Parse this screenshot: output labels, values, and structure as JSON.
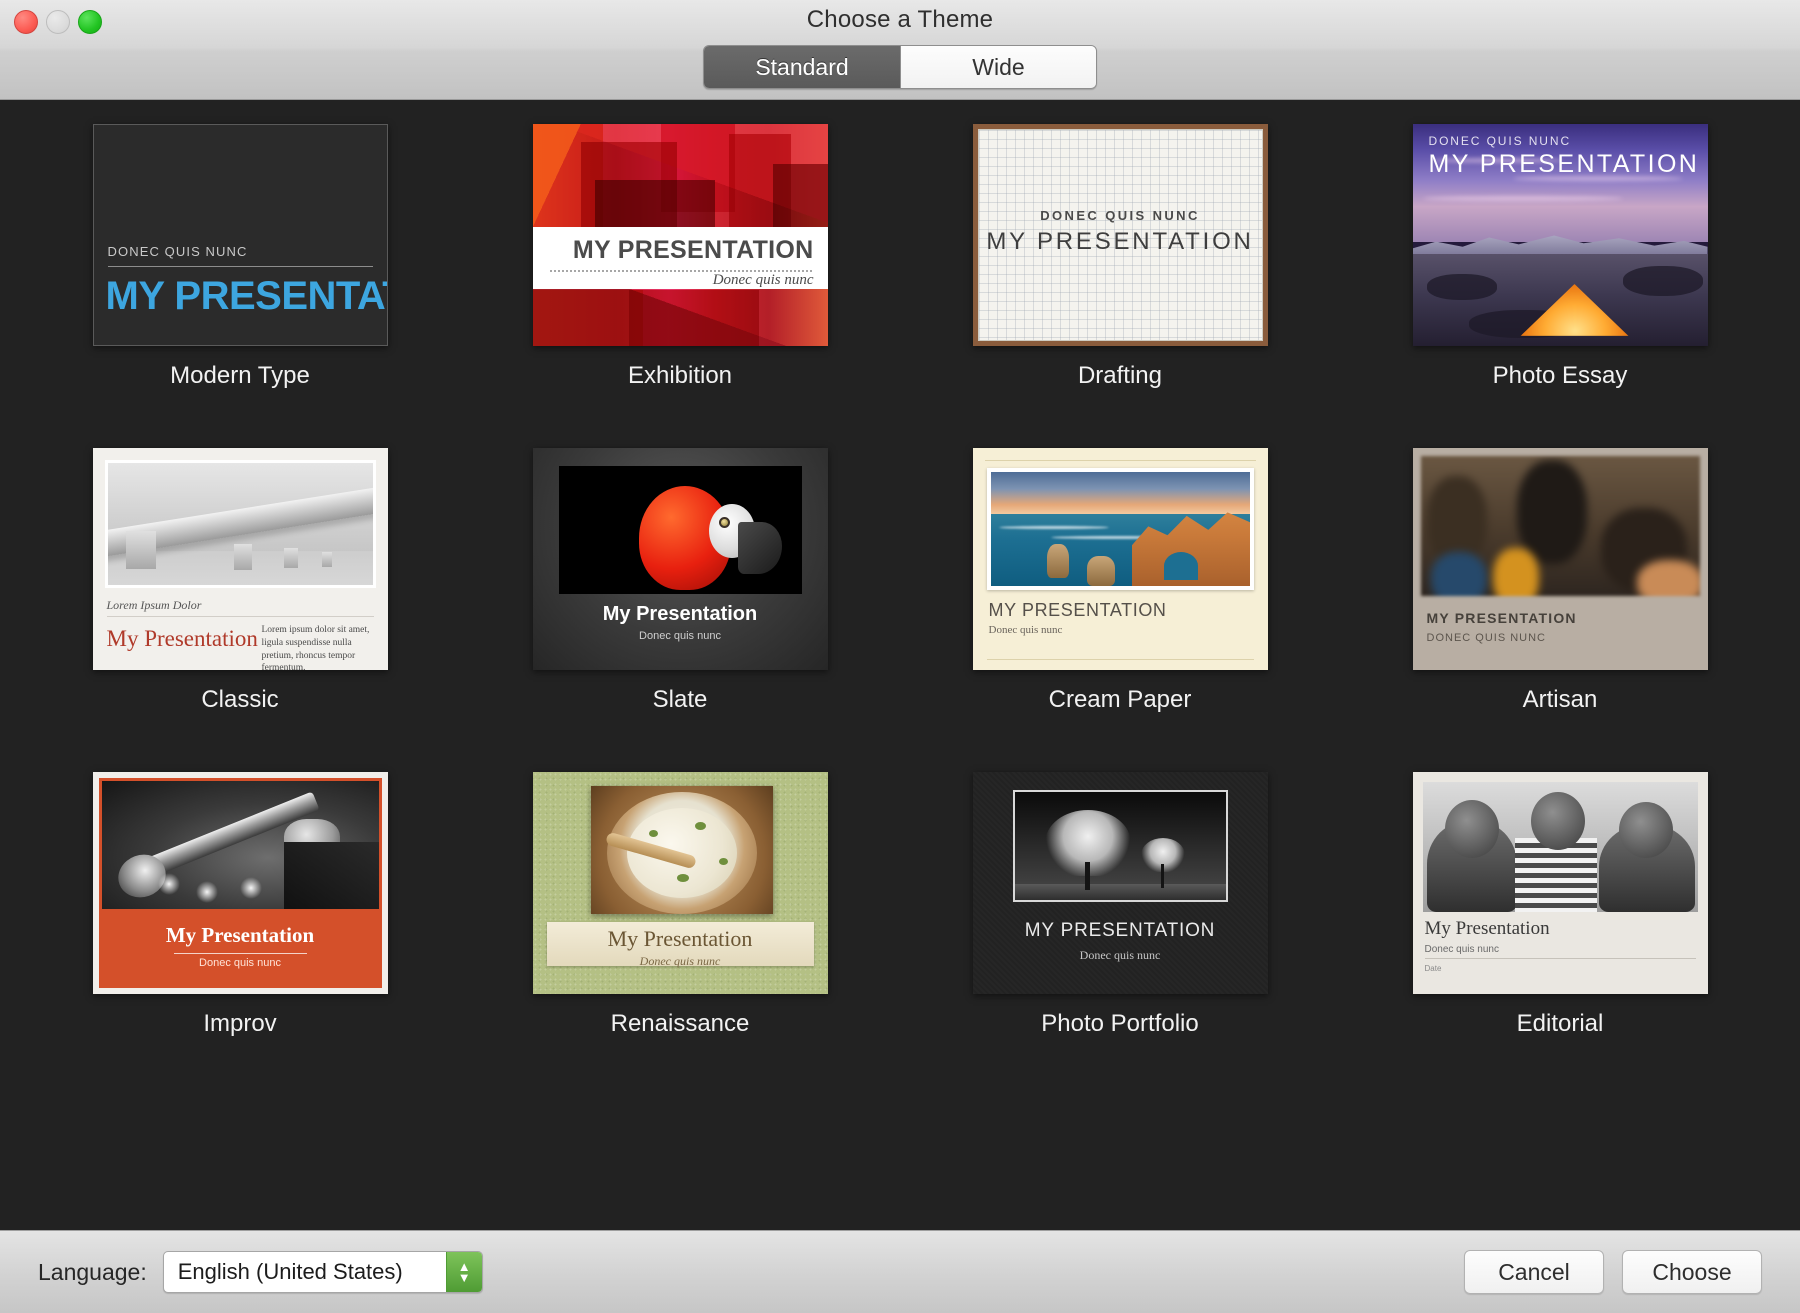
{
  "window": {
    "title": "Choose a Theme",
    "traffic_lights": [
      "close",
      "minimize",
      "zoom"
    ]
  },
  "segmented_control": {
    "options": [
      "Standard",
      "Wide"
    ],
    "selected": "Standard"
  },
  "sample_text": {
    "title_caps": "MY PRESENTATION",
    "title_mixed": "My Presentation",
    "subtitle_caps": "DONEC QUIS NUNC",
    "subtitle_mixed": "Donec quis nunc",
    "caption": "Lorem Ipsum Dolor",
    "body": "Lorem ipsum dolor sit amet, ligula suspendisse nulla pretium, rhoncus tempor fermentum.",
    "date": "Date"
  },
  "themes": [
    {
      "name": "Modern Type",
      "row": 1,
      "col": 1
    },
    {
      "name": "Exhibition",
      "row": 1,
      "col": 2
    },
    {
      "name": "Drafting",
      "row": 1,
      "col": 3
    },
    {
      "name": "Photo Essay",
      "row": 1,
      "col": 4
    },
    {
      "name": "Classic",
      "row": 2,
      "col": 1
    },
    {
      "name": "Slate",
      "row": 2,
      "col": 2
    },
    {
      "name": "Cream Paper",
      "row": 2,
      "col": 3
    },
    {
      "name": "Artisan",
      "row": 2,
      "col": 4
    },
    {
      "name": "Improv",
      "row": 3,
      "col": 1
    },
    {
      "name": "Renaissance",
      "row": 3,
      "col": 2
    },
    {
      "name": "Photo Portfolio",
      "row": 3,
      "col": 3
    },
    {
      "name": "Editorial",
      "row": 3,
      "col": 4
    }
  ],
  "footer": {
    "language_label": "Language:",
    "language_value": "English (United States)",
    "cancel_label": "Cancel",
    "choose_label": "Choose"
  },
  "colors": {
    "window_chrome": "#d2d2d2",
    "content_background": "#222222",
    "accent_blue": "#3da6e0",
    "accent_red": "#d4502a",
    "stepper_green": "#4f9c34",
    "close_red": "#fc5b53",
    "zoom_green": "#22c422"
  }
}
